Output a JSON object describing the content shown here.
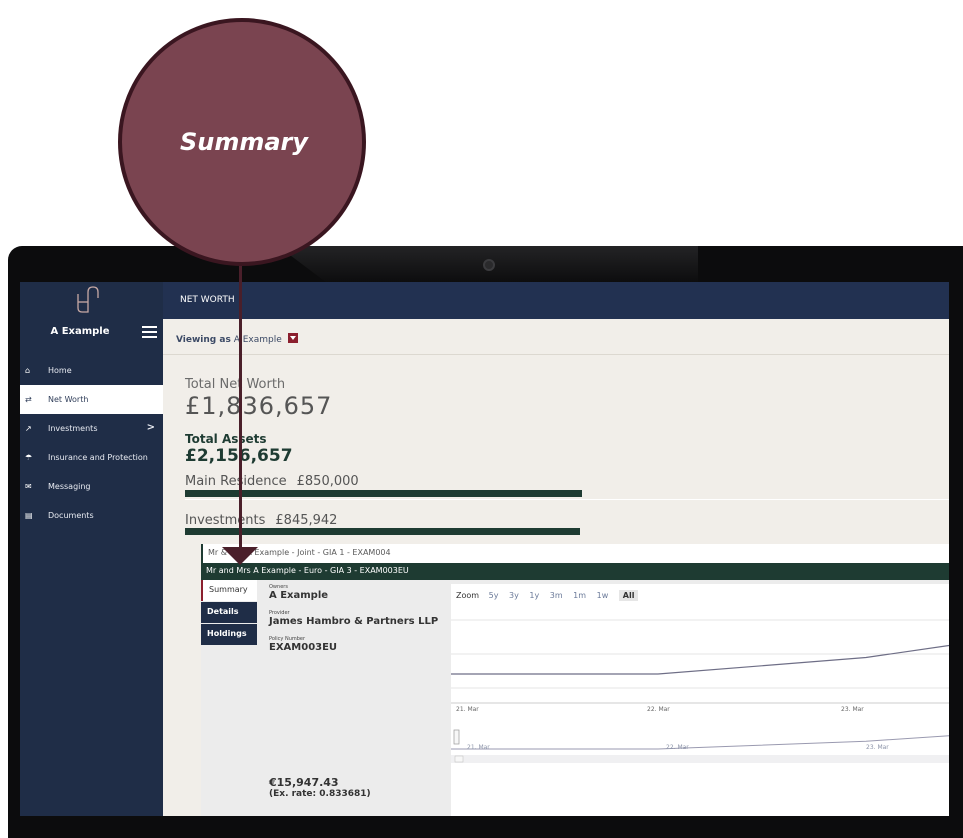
{
  "callout": {
    "label": "Summary"
  },
  "topbar": {
    "title": "NET WORTH"
  },
  "sidebar": {
    "profile_name": "A Example",
    "items": [
      {
        "label": "Home",
        "icon": "home-icon",
        "glyph": "⌂"
      },
      {
        "label": "Net Worth",
        "icon": "transfer-icon",
        "glyph": "⇄"
      },
      {
        "label": "Investments",
        "icon": "chart-icon",
        "glyph": "↗",
        "chevron": ">"
      },
      {
        "label": "Insurance and Protection",
        "icon": "umbrella-icon",
        "glyph": "☂"
      },
      {
        "label": "Messaging",
        "icon": "envelope-icon",
        "glyph": "✉"
      },
      {
        "label": "Documents",
        "icon": "document-icon",
        "glyph": "▤"
      }
    ]
  },
  "viewing": {
    "prefix": "Viewing as",
    "name": "A Example"
  },
  "summary": {
    "total_net_worth_label": "Total Net Worth",
    "total_net_worth_value": "£1,836,657",
    "total_assets_label": "Total Assets",
    "total_assets_value": "£2,156,657",
    "assets": [
      {
        "name": "Main Residence",
        "amount": "£850,000"
      },
      {
        "name": "Investments",
        "amount": "£845,942"
      }
    ]
  },
  "accounts": [
    {
      "label": "Mr & Mrs A Example - Joint - GIA 1 - EXAM004"
    },
    {
      "label": "Mr and Mrs A Example - Euro - GIA 3 - EXAM003EU"
    }
  ],
  "panel": {
    "tabs": [
      "Summary",
      "Details",
      "Holdings"
    ],
    "owners_label": "Owners",
    "owners_value": "A Example",
    "provider_label": "Provider",
    "provider_value": "James Hambro & Partners LLP",
    "policy_label": "Policy Number",
    "policy_value": "EXAM003EU",
    "value": "€15,947.43",
    "rate": "(Ex. rate: 0.833681)"
  },
  "chart_data": {
    "type": "line",
    "zoom_label": "Zoom",
    "zoom_options": [
      "5y",
      "3y",
      "1y",
      "3m",
      "1m",
      "1w",
      "All"
    ],
    "zoom_selected": "All",
    "x": [
      "21. Mar",
      "22. Mar",
      "23. Mar"
    ],
    "series": [
      {
        "values": [
          0.0,
          0.0,
          0.55,
          0.95
        ]
      }
    ],
    "navigator_x": [
      "21. Mar",
      "22. Mar",
      "23. Mar"
    ],
    "line_color": "#6e6e86"
  }
}
